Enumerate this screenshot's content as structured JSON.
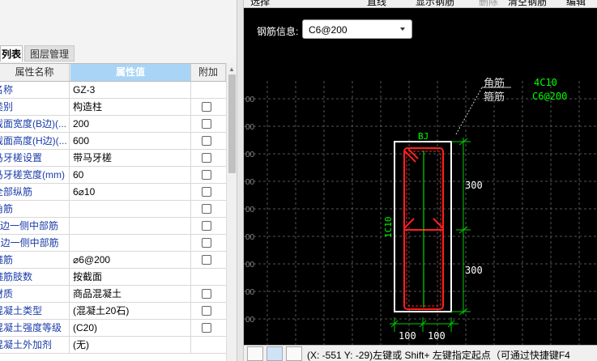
{
  "tabs": [
    "列表",
    "图层管理"
  ],
  "table": {
    "headers": [
      "属性名称",
      "属性值",
      "附加"
    ],
    "rows": [
      {
        "name": "名称",
        "value": "GZ-3",
        "check": false
      },
      {
        "name": "类别",
        "value": "构造柱",
        "check": true
      },
      {
        "name": "截面宽度(B边)(...",
        "value": "200",
        "check": true
      },
      {
        "name": "截面高度(H边)(...",
        "value": "600",
        "check": true
      },
      {
        "name": "马牙槎设置",
        "value": "带马牙槎",
        "check": true
      },
      {
        "name": "马牙槎宽度(mm)",
        "value": "60",
        "check": true
      },
      {
        "name": "全部纵筋",
        "value": "6⌀10",
        "check": true
      },
      {
        "name": "角筋",
        "value": "",
        "check": true
      },
      {
        "name": "B边一侧中部筋",
        "value": "",
        "check": true
      },
      {
        "name": "H边一侧中部筋",
        "value": "",
        "check": true
      },
      {
        "name": "箍筋",
        "value": "⌀6@200",
        "check": true
      },
      {
        "name": "箍筋肢数",
        "value": "按截面",
        "check": false
      },
      {
        "name": "材质",
        "value": "商品混凝土",
        "check": true
      },
      {
        "name": "混凝土类型",
        "value": "(混凝土20石)",
        "check": true
      },
      {
        "name": "混凝土强度等级",
        "value": "(C20)",
        "check": true
      },
      {
        "name": "混凝土外加剂",
        "value": "(无)",
        "check": false
      }
    ]
  },
  "right": {
    "toolbar": [
      "选择",
      "",
      "",
      "直线",
      "显示钢筋",
      "删除",
      "清空钢筋",
      "编辑"
    ],
    "rebar_label": "钢筋信息:",
    "rebar_value": "C6@200",
    "ann_corner_label": "角筋",
    "ann_corner_value": "4C10",
    "ann_stirrup_label": "箍筋",
    "ann_stirrup_value": "C6@200",
    "bj": "BJ",
    "side": "1C10",
    "dim_h1": "300",
    "dim_h2": "300",
    "dim_b1": "100",
    "dim_b2": "100",
    "coords_text": "(X: -551 Y: -29)左键或 Shift+ 左键指定起点（可通过快捷键F4"
  },
  "colors": {
    "canvas_bg": "#000000",
    "rebar": "#ff2020",
    "dim": "#00ff00",
    "annotation": "#00ff00",
    "outline": "#ffffff"
  }
}
